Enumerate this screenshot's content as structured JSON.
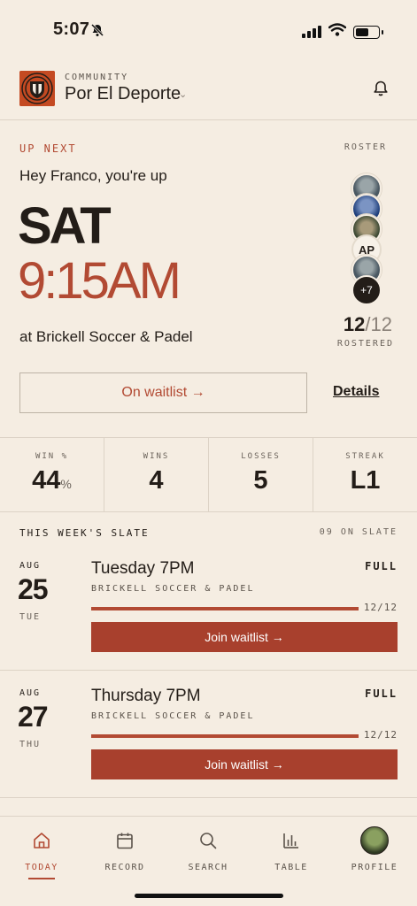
{
  "status_bar": {
    "time": "5:07"
  },
  "community": {
    "label": "COMMUNITY",
    "name": "Por El Deporte"
  },
  "up_next": {
    "label": "UP NEXT",
    "roster_label": "ROSTER",
    "greeting": "Hey Franco, you're up",
    "day": "SAT",
    "time": "9:15AM",
    "venue": "at Brickell Soccer & Padel",
    "avatar_initials": "AP",
    "more_players": "+7",
    "rostered_count": "12",
    "rostered_total": "12",
    "rostered_label": "ROSTERED",
    "waitlist_button": "On waitlist →",
    "details_link": "Details"
  },
  "stats": [
    {
      "label": "WIN %",
      "value": "44",
      "unit": "%"
    },
    {
      "label": "WINS",
      "value": "4",
      "unit": ""
    },
    {
      "label": "LOSSES",
      "value": "5",
      "unit": ""
    },
    {
      "label": "STREAK",
      "value": "L1",
      "unit": ""
    }
  ],
  "slate": {
    "title": "THIS WEEK'S SLATE",
    "count": "09 ON SLATE",
    "games": [
      {
        "month": "AUG",
        "day": "25",
        "dow": "TUE",
        "title": "Tuesday 7PM",
        "status": "FULL",
        "venue": "BRICKELL SOCCER & PADEL",
        "spots": "12/12",
        "fill": 1.0,
        "button": "Join waitlist →"
      },
      {
        "month": "AUG",
        "day": "27",
        "dow": "THU",
        "title": "Thursday 7PM",
        "status": "FULL",
        "venue": "BRICKELL SOCCER & PADEL",
        "spots": "12/12",
        "fill": 1.0,
        "button": "Join waitlist →"
      }
    ]
  },
  "tabs": [
    {
      "label": "TODAY",
      "icon": "home-icon",
      "active": true
    },
    {
      "label": "RECORD",
      "icon": "calendar-icon",
      "active": false
    },
    {
      "label": "SEARCH",
      "icon": "search-icon",
      "active": false
    },
    {
      "label": "TABLE",
      "icon": "bar-chart-icon",
      "active": false
    },
    {
      "label": "PROFILE",
      "icon": "profile-avatar",
      "active": false
    }
  ],
  "colors": {
    "accent": "#b24a33",
    "background": "#f5ede2",
    "text": "#231d18"
  }
}
